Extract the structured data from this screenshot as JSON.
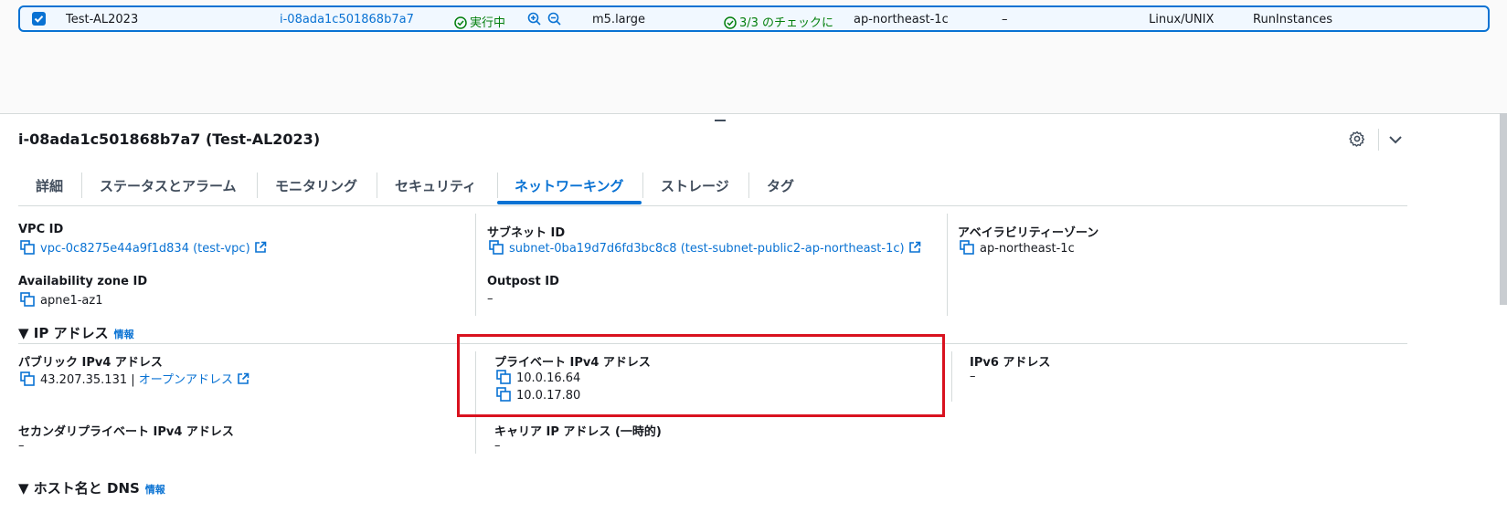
{
  "instance_row": {
    "name": "Test-AL2023",
    "instance_id": "i-08ada1c501868b7a7",
    "state": "実行中",
    "instance_type": "m5.large",
    "status_check": "3/3 のチェックに",
    "az": "ap-northeast-1c",
    "alarm": "–",
    "platform": "Linux/UNIX",
    "launch_method": "RunInstances"
  },
  "details": {
    "title": "i-08ada1c501868b7a7 (Test-AL2023)"
  },
  "tabs": [
    {
      "label": "詳細"
    },
    {
      "label": "ステータスとアラーム"
    },
    {
      "label": "モニタリング"
    },
    {
      "label": "セキュリティ"
    },
    {
      "label": "ネットワーキング"
    },
    {
      "label": "ストレージ"
    },
    {
      "label": "タグ"
    }
  ],
  "network": {
    "vpc_label": "VPC ID",
    "vpc_value": "vpc-0c8275e44a9f1d834 (test-vpc)",
    "subnet_label": "サブネット ID",
    "subnet_value": "subnet-0ba19d7d6fd3bc8c8 (test-subnet-public2-ap-northeast-1c)",
    "avail_label": "アベイラビリティーゾーン",
    "avail_value": "ap-northeast-1c",
    "azid_label": "Availability zone ID",
    "azid_value": "apne1-az1",
    "outpost_label": "Outpost ID",
    "outpost_value": "–"
  },
  "ip_section": {
    "title": "IP アドレス",
    "info": "情報",
    "public_label": "パブリック IPv4 アドレス",
    "public_value": "43.207.35.131",
    "public_sep": "|",
    "open_address": "オープンアドレス",
    "private_label": "プライベート IPv4 アドレス",
    "private_values": [
      "10.0.16.64",
      "10.0.17.80"
    ],
    "ipv6_label": "IPv6 アドレス",
    "ipv6_value": "–",
    "secondary_label": "セカンダリプライベート IPv4 アドレス",
    "secondary_value": "–",
    "carrier_label": "キャリア IP アドレス (一時的)",
    "carrier_value": "–"
  },
  "host_section": {
    "title": "ホスト名と DNS",
    "info": "情報"
  },
  "colors": {
    "link": "#0972d3",
    "success": "#037f0c",
    "highlight": "#d9121f"
  }
}
